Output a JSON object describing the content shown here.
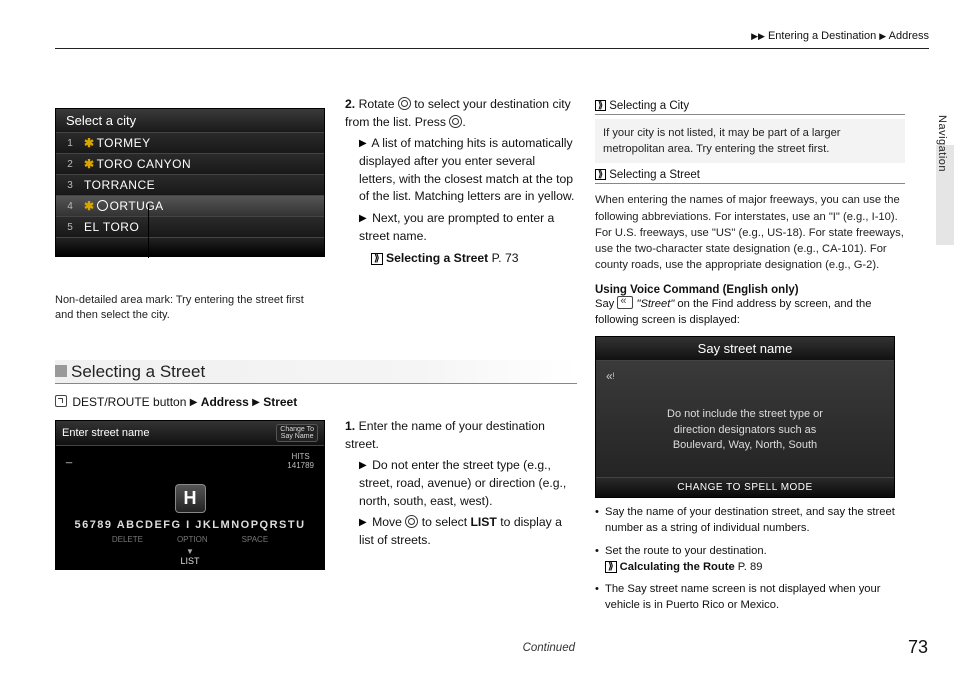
{
  "header": {
    "crumb1": "Entering a Destination",
    "crumb2": "Address"
  },
  "sideTab": "Navigation",
  "pageNumber": "73",
  "continued": "Continued",
  "screenshot1": {
    "title": "Select a city",
    "rows": [
      {
        "n": "1",
        "aster": true,
        "name": "TORMEY"
      },
      {
        "n": "2",
        "aster": true,
        "name": "TORO CANYON"
      },
      {
        "n": "3",
        "aster": false,
        "name": "TORRANCE"
      },
      {
        "n": "4",
        "aster": true,
        "name": "ORTUGA",
        "cursor": true
      },
      {
        "n": "5",
        "aster": false,
        "name": "EL TORO"
      }
    ],
    "caption": "Non-detailed area mark: Try entering the street first and then select the city."
  },
  "step2": {
    "lead": "Rotate",
    "text1": "to select your destination city from the list. Press",
    "bullet1": "A list of matching hits is automatically displayed after you enter several letters, with the closest match at the top of the list. Matching letters are in yellow.",
    "bullet2": "Next, you are prompted to enter a street name.",
    "xref": "Selecting a Street",
    "xrefPage": "P. 73"
  },
  "section": {
    "title": "Selecting a Street",
    "crumbLead": "DEST/ROUTE button",
    "crumb1": "Address",
    "crumb2": "Street"
  },
  "screenshot2": {
    "title": "Enter street name",
    "change1": "Change To",
    "change2": "Say Name",
    "dash": "_",
    "hitsLabel": "HITS",
    "hits": "141789",
    "big": "H",
    "alpha": "56789  ABCDEFG   I JKLMNOPQRSTU",
    "delete": "DELETE",
    "option": "OPTION",
    "space": "SPACE",
    "list": "LIST"
  },
  "step1": {
    "text": "Enter the name of your destination street.",
    "b1": "Do not enter the street type (e.g., street, road, avenue) or direction (e.g., north, south, east, west).",
    "b2a": "Move",
    "b2b": "to select",
    "b2list": "LIST",
    "b2c": "to display a list of streets."
  },
  "sidebar": {
    "h1": "Selecting a City",
    "p1": "If your city is not listed, it may be part of a larger metropolitan area. Try entering the street first.",
    "h2": "Selecting a Street",
    "p2": "When entering the names of major freeways, you can use the following abbreviations. For interstates, use an \"I\" (e.g., I-10). For U.S. freeways, use \"US\" (e.g., US-18). For state freeways, use the two-character state designation (e.g., CA-101). For county roads, use the appropriate designation (e.g., G-2).",
    "voiceTitle": "Using Voice Command (English only)",
    "voice1a": "Say",
    "voice1b": "\"Street\"",
    "voice1c": "on the Find address by screen, and the following screen is displayed:",
    "vscrTitle": "Say street name",
    "vscrMsg1": "Do not include the street type or",
    "vscrMsg2": "direction designators such as",
    "vscrMsg3": "Boulevard, Way, North, South",
    "vscrFoot": "CHANGE TO SPELL MODE",
    "bul1": "Say the name of your destination street, and say the street number as a string of individual numbers.",
    "bul2": "Set the route to your destination.",
    "bul2x": "Calculating the Route",
    "bul2p": "P. 89",
    "bul3": "The Say street name screen is not displayed when your vehicle is in Puerto Rico or Mexico."
  }
}
